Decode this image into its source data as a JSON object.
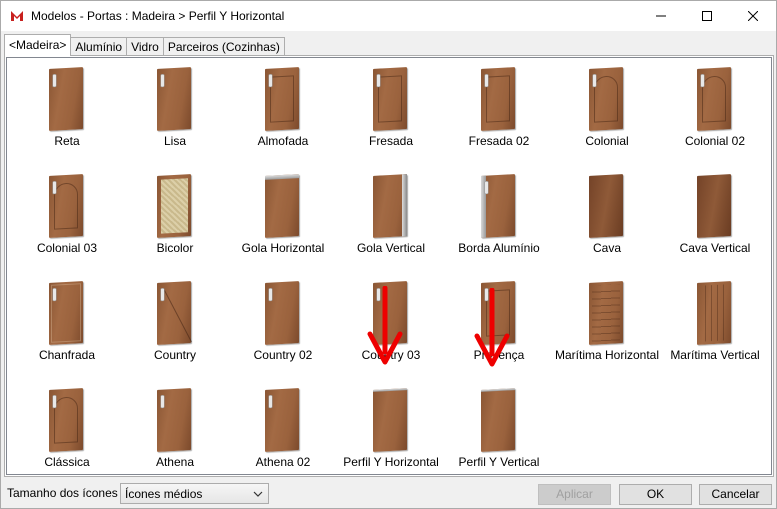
{
  "window": {
    "title": "Modelos - Portas : Madeira > Perfil Y Horizontal",
    "logo_color": "#c8201e"
  },
  "tabs": [
    {
      "label": "<Madeira>",
      "active": true
    },
    {
      "label": "Alumínio",
      "active": false
    },
    {
      "label": "Vidro",
      "active": false
    },
    {
      "label": "Parceiros (Cozinhas)",
      "active": false
    }
  ],
  "models": [
    {
      "label": "Reta",
      "style": "plain"
    },
    {
      "label": "Lisa",
      "style": "plain"
    },
    {
      "label": "Almofada",
      "style": "panel"
    },
    {
      "label": "Fresada",
      "style": "panel"
    },
    {
      "label": "Fresada 02",
      "style": "panel"
    },
    {
      "label": "Colonial",
      "style": "arch"
    },
    {
      "label": "Colonial 02",
      "style": "arch"
    },
    {
      "label": "Colonial 03",
      "style": "arch"
    },
    {
      "label": "Bicolor",
      "style": "cane"
    },
    {
      "label": "Gola Horizontal",
      "style": "gola-h"
    },
    {
      "label": "Gola Vertical",
      "style": "gola-v"
    },
    {
      "label": "Borda Alumínio",
      "style": "alu"
    },
    {
      "label": "Cava",
      "style": "plain-dark"
    },
    {
      "label": "Cava Vertical",
      "style": "plain-dark"
    },
    {
      "label": "Chanfrada",
      "style": "chamfer"
    },
    {
      "label": "Country",
      "style": "diag"
    },
    {
      "label": "Country 02",
      "style": "plain"
    },
    {
      "label": "Country 03",
      "style": "plain"
    },
    {
      "label": "Provença",
      "style": "panel"
    },
    {
      "label": "Marítima Horizontal",
      "style": "grooves-h"
    },
    {
      "label": "Marítima Vertical",
      "style": "grooves-v"
    },
    {
      "label": "Clássica",
      "style": "arch"
    },
    {
      "label": "Athena",
      "style": "plain"
    },
    {
      "label": "Athena 02",
      "style": "plain"
    },
    {
      "label": "Perfil Y Horizontal",
      "style": "profile"
    },
    {
      "label": "Perfil Y Vertical",
      "style": "profile"
    }
  ],
  "annotation": {
    "arrow_color": "#ee0000"
  },
  "footer": {
    "icon_size_label": "Tamanho dos ícones",
    "icon_size_value": "Ícones médios",
    "apply_label": "Aplicar",
    "ok_label": "OK",
    "cancel_label": "Cancelar"
  }
}
